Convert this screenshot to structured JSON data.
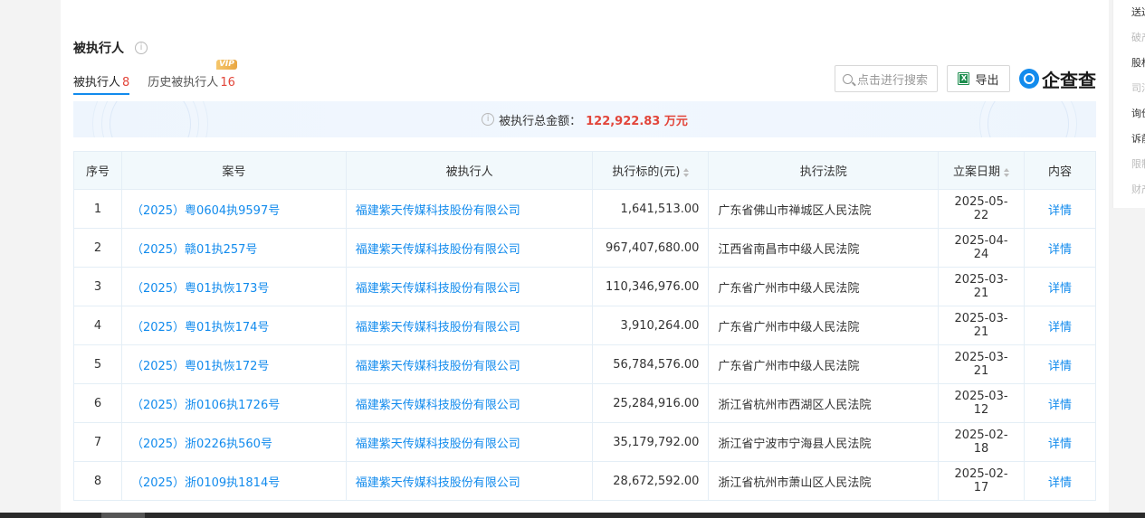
{
  "section": {
    "title": "被执行人"
  },
  "tabs": [
    {
      "label": "被执行人",
      "count": "8"
    },
    {
      "label": "历史被执行人",
      "count": "16",
      "badge": "VIP"
    }
  ],
  "toolbar": {
    "search_placeholder": "点击进行搜索",
    "export_label": "导出",
    "logo_text": "企查查"
  },
  "summary": {
    "label": "被执行总金额：",
    "value": "122,922.83 万元"
  },
  "table": {
    "headers": [
      "序号",
      "案号",
      "被执行人",
      "执行标的(元)",
      "执行法院",
      "立案日期",
      "内容"
    ],
    "rows": [
      {
        "no": "1",
        "case": "（2025）粤0604执9597号",
        "party": "福建紫天传媒科技股份有限公司",
        "amount": "1,641,513.00",
        "court": "广东省佛山市禅城区人民法院",
        "date": "2025-05-22",
        "action": "详情"
      },
      {
        "no": "2",
        "case": "（2025）赣01执257号",
        "party": "福建紫天传媒科技股份有限公司",
        "amount": "967,407,680.00",
        "court": "江西省南昌市中级人民法院",
        "date": "2025-04-24",
        "action": "详情"
      },
      {
        "no": "3",
        "case": "（2025）粤01执恢173号",
        "party": "福建紫天传媒科技股份有限公司",
        "amount": "110,346,976.00",
        "court": "广东省广州市中级人民法院",
        "date": "2025-03-21",
        "action": "详情"
      },
      {
        "no": "4",
        "case": "（2025）粤01执恢174号",
        "party": "福建紫天传媒科技股份有限公司",
        "amount": "3,910,264.00",
        "court": "广东省广州市中级人民法院",
        "date": "2025-03-21",
        "action": "详情"
      },
      {
        "no": "5",
        "case": "（2025）粤01执恢172号",
        "party": "福建紫天传媒科技股份有限公司",
        "amount": "56,784,576.00",
        "court": "广东省广州市中级人民法院",
        "date": "2025-03-21",
        "action": "详情"
      },
      {
        "no": "6",
        "case": "（2025）浙0106执1726号",
        "party": "福建紫天传媒科技股份有限公司",
        "amount": "25,284,916.00",
        "court": "浙江省杭州市西湖区人民法院",
        "date": "2025-03-12",
        "action": "详情"
      },
      {
        "no": "7",
        "case": "（2025）浙0226执560号",
        "party": "福建紫天传媒科技股份有限公司",
        "amount": "35,179,792.00",
        "court": "浙江省宁波市宁海县人民法院",
        "date": "2025-02-18",
        "action": "详情"
      },
      {
        "no": "8",
        "case": "（2025）浙0109执1814号",
        "party": "福建紫天传媒科技股份有限公司",
        "amount": "28,672,592.00",
        "court": "浙江省杭州市萧山区人民法院",
        "date": "2025-02-17",
        "action": "详情"
      }
    ]
  },
  "right_nav": [
    "送达",
    "破产",
    "股权",
    "司法",
    "询价",
    "诉前",
    "限制",
    "财产"
  ],
  "colors": {
    "accent": "#128bed",
    "highlight": "#e2453a"
  }
}
